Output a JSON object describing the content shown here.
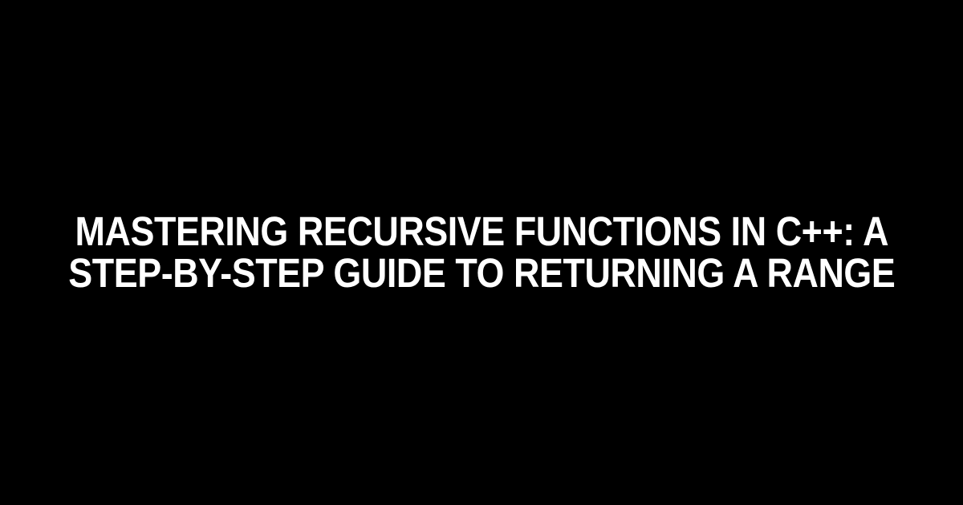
{
  "title_text": "Mastering Recursive Functions in C++: A\nStep-by-Step Guide to Returning a Range"
}
